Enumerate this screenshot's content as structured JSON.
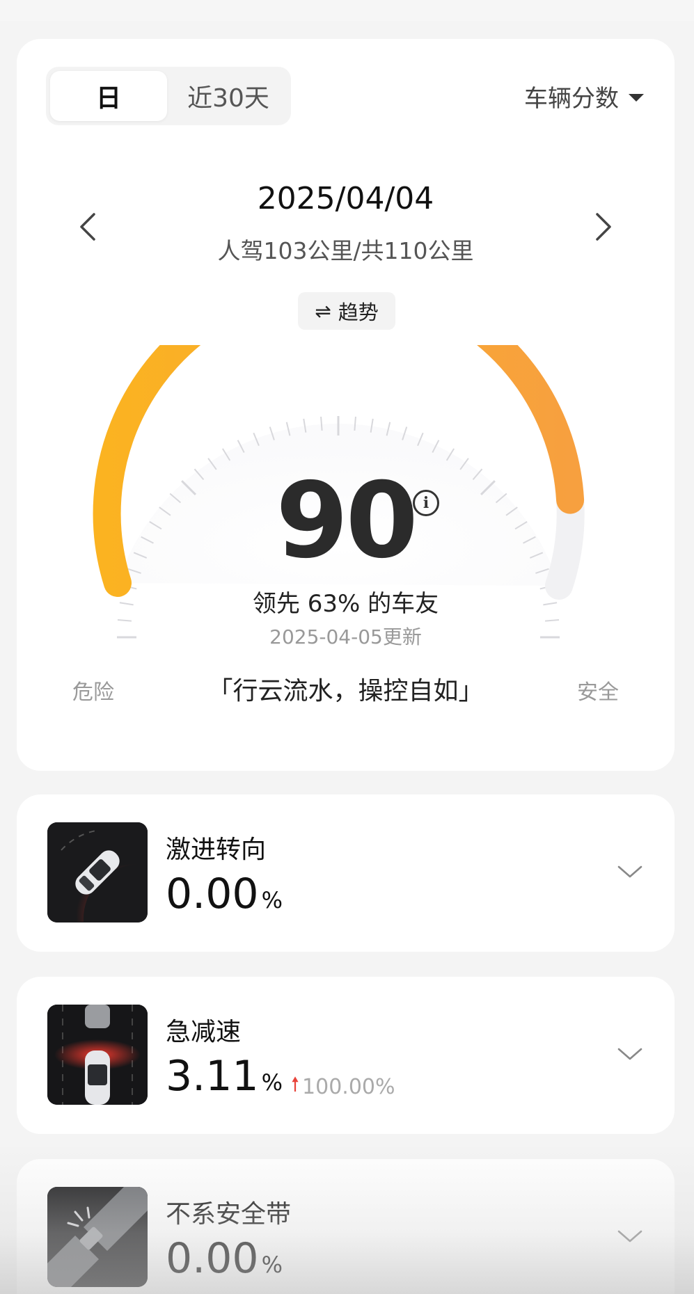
{
  "tabs": {
    "day": "日",
    "last30": "近30天"
  },
  "vehicle_selector": {
    "label": "车辆分数"
  },
  "date": "2025/04/04",
  "distance": "人驾103公里/共110公里",
  "trend_button": {
    "icon": "⇌",
    "label": "趋势"
  },
  "score": {
    "value": "90",
    "level": 0.9,
    "lead_text": "领先 63% 的车友",
    "updated_text": "2025-04-05更新",
    "slogan": "「行云流水，操控自如」",
    "label_left": "危险",
    "label_right": "安全"
  },
  "metrics": [
    {
      "title": "激进转向",
      "value": "0.00",
      "unit": "%",
      "icon": "aggressive-steering-icon"
    },
    {
      "title": "急减速",
      "value": "3.11",
      "unit": "%",
      "change": "100.00%",
      "change_dir": "up",
      "icon": "hard-braking-icon"
    },
    {
      "title": "不系安全带",
      "value": "0.00",
      "unit": "%",
      "icon": "seatbelt-icon"
    }
  ],
  "colors": {
    "gauge_start": "#fbb321",
    "gauge_end": "#f7a03f",
    "change_up": "#e8433a"
  }
}
